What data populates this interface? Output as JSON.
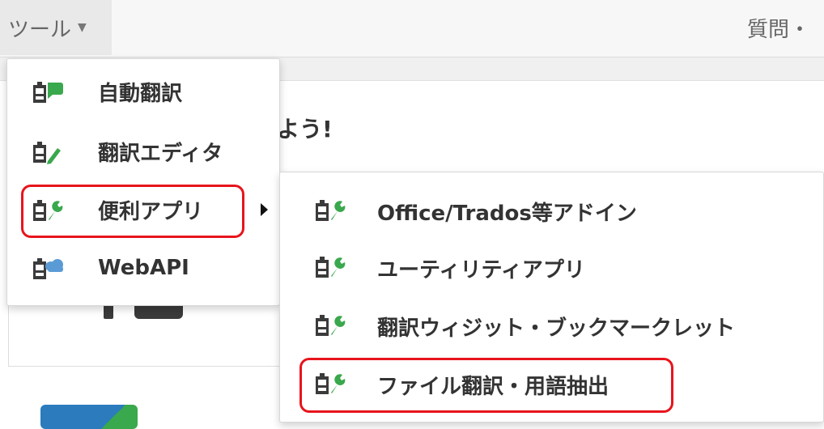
{
  "header": {
    "tools_label": "ツール",
    "help_label": "質問・"
  },
  "main": {
    "welcome_text": "よう!"
  },
  "dropdown": {
    "items": [
      {
        "label": "自動翻訳",
        "icon": "auto-translate-icon"
      },
      {
        "label": "翻訳エディタ",
        "icon": "translation-editor-icon"
      },
      {
        "label": "便利アプリ",
        "icon": "app-tools-icon",
        "has_submenu": true,
        "highlighted": true
      },
      {
        "label": "WebAPI",
        "icon": "webapi-cloud-icon"
      }
    ]
  },
  "submenu": {
    "items": [
      {
        "label": "Office/Trados等アドイン",
        "icon": "wrench-icon"
      },
      {
        "label": "ユーティリティアプリ",
        "icon": "wrench-icon"
      },
      {
        "label": "翻訳ウィジット・ブックマークレット",
        "icon": "wrench-icon"
      },
      {
        "label": "ファイル翻訳・用語抽出",
        "icon": "wrench-icon",
        "highlighted": true
      }
    ]
  },
  "colors": {
    "icon_dark": "#3b3b3b",
    "icon_green": "#3aa84c",
    "icon_blue": "#5b9bd5",
    "highlight_red": "#e8141c"
  }
}
